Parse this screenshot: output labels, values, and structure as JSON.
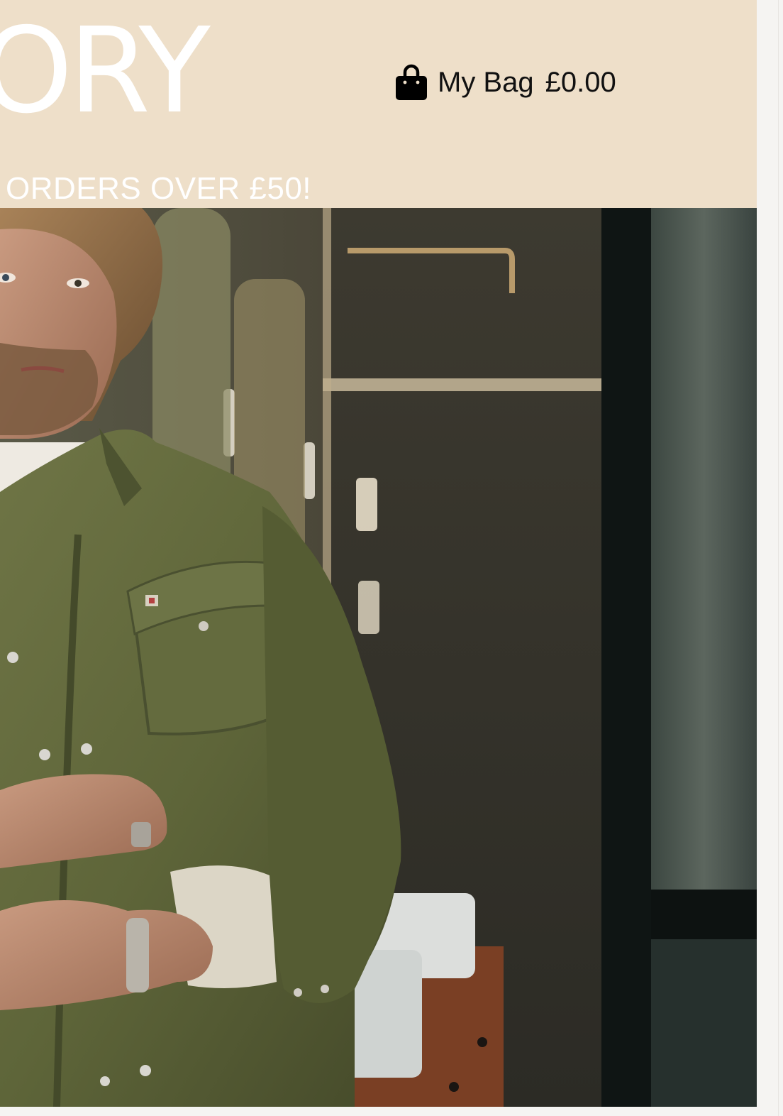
{
  "header": {
    "logo_text": "ORY",
    "bag": {
      "icon": "shopping-bag-icon",
      "label": "My Bag",
      "total": "£0.00"
    }
  },
  "banner": {
    "text": "ORDERS OVER £50!"
  },
  "hero": {
    "image": "man-in-olive-shirt-photo"
  },
  "colors": {
    "header_bg": "#eedfc9",
    "banner_text": "#ffffff",
    "bag_text": "#111111",
    "page_bg": "#f5f4f2"
  }
}
